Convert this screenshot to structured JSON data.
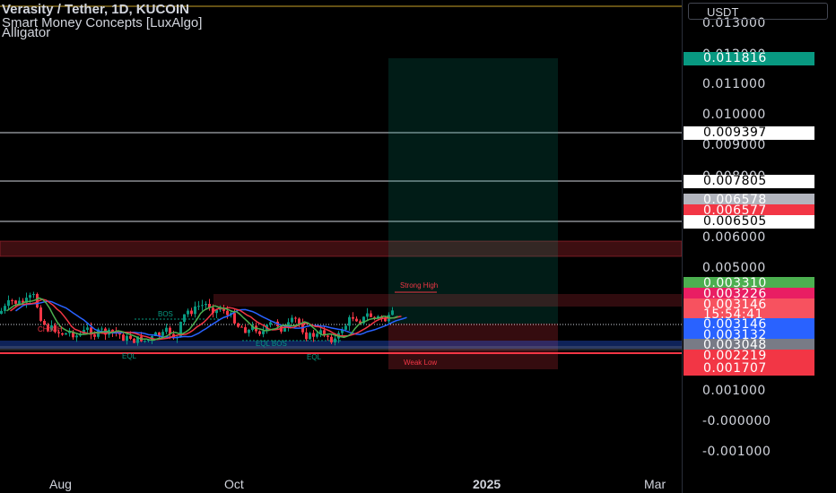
{
  "header": {
    "symbol_line": "Verasity / Tether, 1D, KUCOIN",
    "indicator_1": "Smart Money Concepts [LuxAlgo]",
    "indicator_2": "Alligator"
  },
  "price_axis": {
    "currency": "USDT",
    "ticks": [
      "0.013000",
      "0.012000",
      "0.011000",
      "0.010000",
      "0.009000",
      "0.008000",
      "0.006000",
      "0.005000",
      "0.001000",
      "-0.000000",
      "-0.001000"
    ],
    "badges": [
      {
        "value": "0.011816",
        "bg": "#089981",
        "fg": "#ffffff"
      },
      {
        "value": "0.009397",
        "bg": "#ffffff",
        "fg": "#000000"
      },
      {
        "value": "0.007805",
        "bg": "#ffffff",
        "fg": "#000000"
      },
      {
        "value": "0.006578",
        "bg": "#b2b5be",
        "fg": "#ffffff"
      },
      {
        "value": "0.006577",
        "bg": "#f23645",
        "fg": "#ffffff"
      },
      {
        "value": "0.006505",
        "bg": "#ffffff",
        "fg": "#000000"
      },
      {
        "value": "0.003310",
        "bg": "#4caf50",
        "fg": "#ffffff"
      },
      {
        "value": "0.003226",
        "bg": "#e91e63",
        "fg": "#ffffff"
      },
      {
        "value": "0.003146",
        "bg": "#f7525f",
        "fg": "#ffffff"
      },
      {
        "value": "15:54:41",
        "bg": "#f7525f",
        "fg": "#ffffff"
      },
      {
        "value": "0.003146",
        "bg": "#2962ff",
        "fg": "#ffffff"
      },
      {
        "value": "0.003132",
        "bg": "#2962ff",
        "fg": "#ffffff"
      },
      {
        "value": "0.003048",
        "bg": "#787b86",
        "fg": "#ffffff"
      },
      {
        "value": "0.002219",
        "bg": "#f23645",
        "fg": "#ffffff"
      },
      {
        "value": "0.001707",
        "bg": "#f23645",
        "fg": "#ffffff"
      }
    ]
  },
  "time_axis": [
    "Aug",
    "Oct",
    "2025",
    "Mar"
  ],
  "annotations": {
    "strong_high": "Strong High",
    "weak_low": "Weak Low",
    "bos_1": "BOS",
    "eql_1": "EQL",
    "eql_bos": "EQL BOS",
    "eql_2": "EQL",
    "choch": "CHoCH"
  },
  "colors": {
    "up": "#089981",
    "down": "#f23645",
    "jaw": "#2962ff",
    "teeth": "#f23645",
    "lips": "#4caf50"
  }
}
